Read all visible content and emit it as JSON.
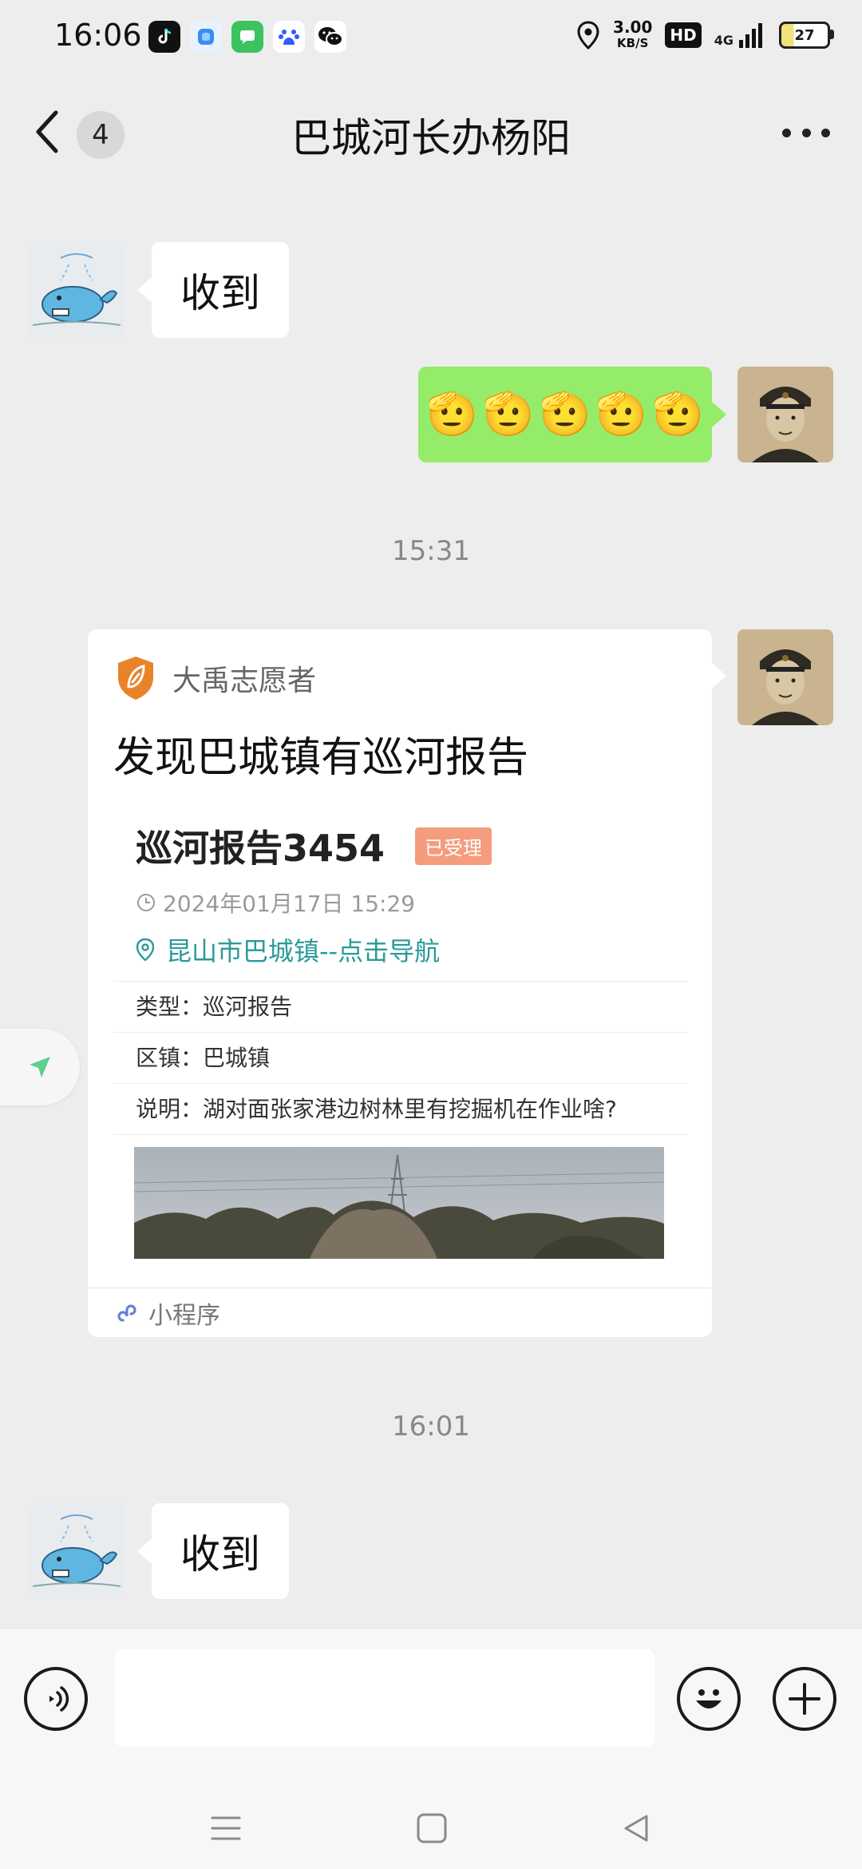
{
  "status_bar": {
    "time": "16:06",
    "net_speed_value": "3.00",
    "net_speed_unit": "KB/S",
    "hd_label": "HD",
    "network": "4G",
    "battery": "27",
    "app_icons": [
      "douyin-icon",
      "browser-icon",
      "messages-icon",
      "baidu-icon",
      "wechat-icon"
    ]
  },
  "header": {
    "back_badge": "4",
    "title": "巴城河长办杨阳"
  },
  "messages": {
    "m1_text": "收到",
    "m2_emoji": [
      "🫡",
      "🫡",
      "🫡",
      "🫡",
      "🫡"
    ],
    "time1": "15:31",
    "time2": "16:01",
    "m4_text": "收到"
  },
  "card": {
    "source": "大禹志愿者",
    "title": "发现巴城镇有巡河报告",
    "report_title": "巡河报告3454",
    "status": "已受理",
    "datetime": "2024年01月17日 15:29",
    "location": "昆山市巴城镇--点击导航",
    "type_row": "类型：巡河报告",
    "town_row": "区镇：巴城镇",
    "desc_row": "说明：湖对面张家港边树林里有挖掘机在作业啥?",
    "footer_label": "小程序"
  },
  "input_bar": {
    "text_value": ""
  },
  "colors": {
    "green_bubble": "#95ec69",
    "chat_bg": "#ededed",
    "status_tag": "#f49c7c",
    "location_link": "#2a9a9a",
    "brand_orange": "#e8832a"
  }
}
